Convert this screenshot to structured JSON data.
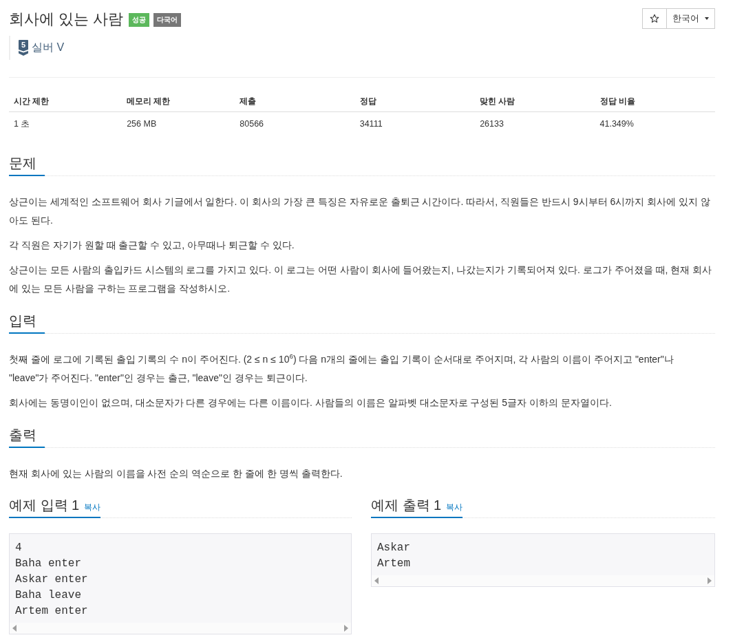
{
  "header": {
    "title": "회사에 있는 사람",
    "badges": [
      {
        "label": "성공",
        "kind": "success"
      },
      {
        "label": "다국어",
        "kind": "language"
      }
    ],
    "language_menu": {
      "label": "한국어"
    }
  },
  "tier": {
    "badge_number": "5",
    "name": "실버 V"
  },
  "stats": {
    "columns": [
      "시간 제한",
      "메모리 제한",
      "제출",
      "정답",
      "맞힌 사람",
      "정답 비율"
    ],
    "rows": [
      [
        "1 초",
        "256 MB",
        "80566",
        "34111",
        "26133",
        "41.349%"
      ]
    ]
  },
  "sections": [
    {
      "heading": "문제",
      "paragraphs": [
        "상근이는 세계적인 소프트웨어 회사 기글에서 일한다. 이 회사의 가장 큰 특징은 자유로운 출퇴근 시간이다. 따라서, 직원들은 반드시 9시부터 6시까지 회사에 있지 않아도 된다.",
        "각 직원은 자기가 원할 때 출근할 수 있고, 아무때나 퇴근할 수 있다.",
        "상근이는 모든 사람의 출입카드 시스템의 로그를 가지고 있다. 이 로그는 어떤 사람이 회사에 들어왔는지, 나갔는지가 기록되어져 있다. 로그가 주어졌을 때, 현재 회사에 있는 모든 사람을 구하는 프로그램을 작성하시오."
      ]
    },
    {
      "heading": "입력",
      "paragraphs": [
        "첫째 줄에 로그에 기록된 출입 기록의 수 n이 주어진다. (2 ≤ n ≤ 10$^{6}$) 다음 n개의 줄에는 출입 기록이 순서대로 주어지며, 각 사람의 이름이 주어지고 \"enter\"나 \"leave\"가 주어진다. \"enter\"인 경우는 출근, \"leave\"인 경우는 퇴근이다.",
        "회사에는 동명이인이 없으며, 대소문자가 다른 경우에는 다른 이름이다. 사람들의 이름은 알파벳 대소문자로 구성된 5글자 이하의 문자열이다."
      ]
    },
    {
      "heading": "출력",
      "paragraphs": [
        "현재 회사에 있는 사람의 이름을 사전 순의 역순으로 한 줄에 한 명씩 출력한다."
      ]
    }
  ],
  "samples": [
    {
      "heading": "예제 입력 1",
      "copy_link": "복사",
      "lines": [
        "4",
        "Baha enter",
        "Askar enter",
        "Baha leave",
        "Artem enter"
      ]
    },
    {
      "heading": "예제 출력 1",
      "copy_link": "복사",
      "lines": [
        "Askar",
        "Artem"
      ]
    }
  ]
}
